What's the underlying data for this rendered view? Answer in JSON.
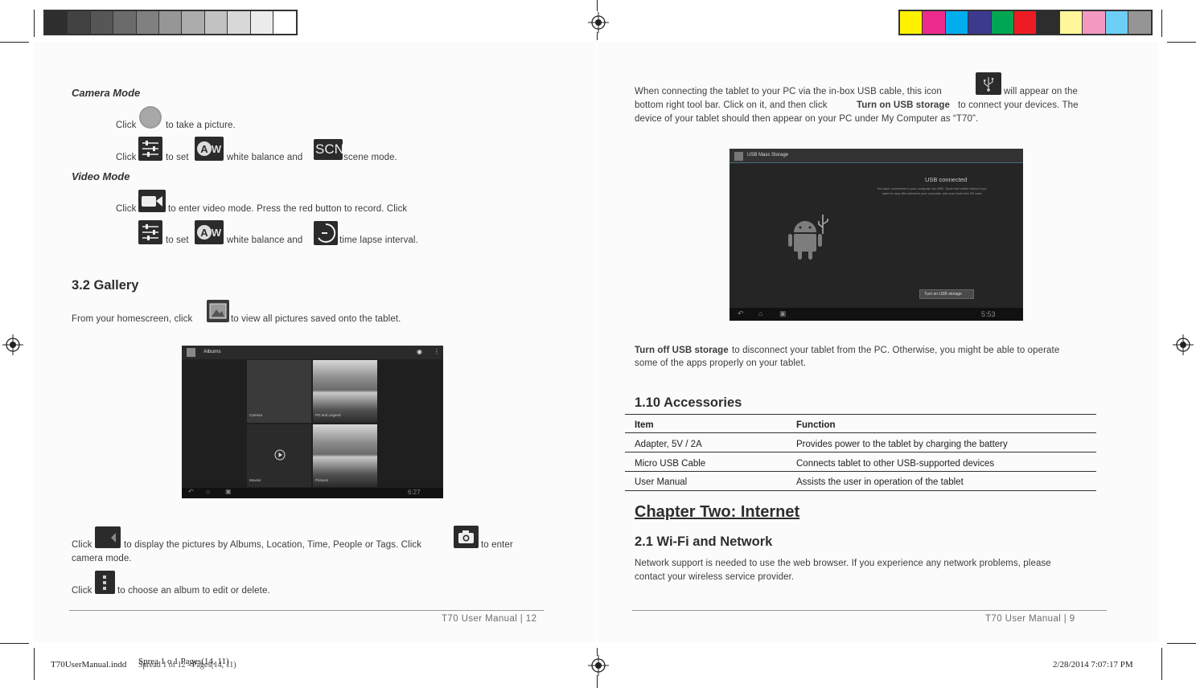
{
  "left_page": {
    "camera_mode": {
      "heading": "Camera Mode",
      "line1_click": "Click",
      "line1_rest": "to take a picture.",
      "line2_click": "Click",
      "line2_to_set": "to set",
      "line2_white_balance": "white balance and",
      "line2_scene": "scene mode.",
      "scn_icon_text": "SCN",
      "aw_icon_text": "AW"
    },
    "video_mode": {
      "heading": "Video Mode",
      "line1_click": "Click",
      "line1_rest": "to enter video mode. Press the red button to record. Click",
      "line2_to_set": "to set",
      "line2_white_balance": "white balance and",
      "line2_time_lapse": "time lapse interval."
    },
    "gallery": {
      "heading": "3.2 Gallery",
      "intro_before": "From your homescreen, click",
      "intro_after": "to view all pictures saved onto the tablet.",
      "screenshot": {
        "app_title": "Albums",
        "album1": "Camera",
        "album2": "PO and Legend",
        "album3": "Movies",
        "album4": "Pictures",
        "clock": "6:27"
      },
      "line_a_click": "Click",
      "line_a_rest": "to display the pictures by Albums, Location, Time, People or Tags. Click",
      "line_a_end": "to enter",
      "line_b": "camera mode.",
      "line_c_click": "Click",
      "line_c_rest": "to choose an album to edit or delete."
    },
    "footer": "T70  User Manual  |  12"
  },
  "right_page": {
    "usb_para": {
      "line1_before": "When connecting the tablet to your PC via the in-box USB cable, this icon",
      "line1_after": "will  appear  on  the",
      "line2_before": "bottom  right  tool  bar.  Click  on  it,  and  then  click",
      "line2_bold": "Turn  on  USB  storage",
      "line2_after": "to  connect  your  devices.  The",
      "line3": "device of your tablet should then appear on your PC under My Computer as “T70”."
    },
    "usb_screenshot": {
      "title_bar": "USB Mass Storage",
      "connected": "USB connected",
      "desc1": "You have connected to your computer via USB. Touch the button below if you",
      "desc2": "want to copy files between your computer and your Android's SD card.",
      "button": "Turn on USB storage",
      "clock": "5:53"
    },
    "turn_off": {
      "bold": "Turn off USB storage",
      "line1_rest": "to disconnect your  tablet from the PC. Otherwise, you might be able to operate",
      "line2": "some of the apps properly on your tablet."
    },
    "accessories": {
      "heading": "1.10 Accessories",
      "columns": [
        "Item",
        "Function"
      ],
      "rows": [
        [
          "Adapter, 5V / 2A",
          "Provides power to the tablet by charging the battery"
        ],
        [
          "Micro USB Cable",
          "Connects tablet to other USB-supported devices"
        ],
        [
          "User Manual",
          "Assists the user in operation of the tablet"
        ]
      ]
    },
    "chapter_two": "Chapter Two: Internet",
    "wifi": {
      "heading": "2.1 Wi-Fi and Network",
      "line1": "Network support is needed to use the web browser. If you experience any network problems, please",
      "line2": "contact your wireless service provider."
    },
    "footer": "T70  User Manual  |  9"
  },
  "slug": {
    "file": "T70UserManual.indd",
    "spread": "Sprea   1  o  1    Pages(14, 11)",
    "spread_ghost": "Spread 1 of 12 - Pages(14, 11)",
    "date": "2/28/2014   7:07:17 PM"
  },
  "colors": {
    "grayscale_bar": [
      "#2e2e2e",
      "#424242",
      "#565656",
      "#6b6b6b",
      "#808080",
      "#969696",
      "#acacac",
      "#c2c2c2",
      "#d8d8d8",
      "#ececec",
      "#ffffff"
    ],
    "color_bar": [
      "#fff200",
      "#ec2b8c",
      "#00aeef",
      "#3b3a8f",
      "#00a651",
      "#ed1c24",
      "#2d2d2d",
      "#fff799",
      "#f49ac1",
      "#6dcff6",
      "#959595"
    ]
  }
}
